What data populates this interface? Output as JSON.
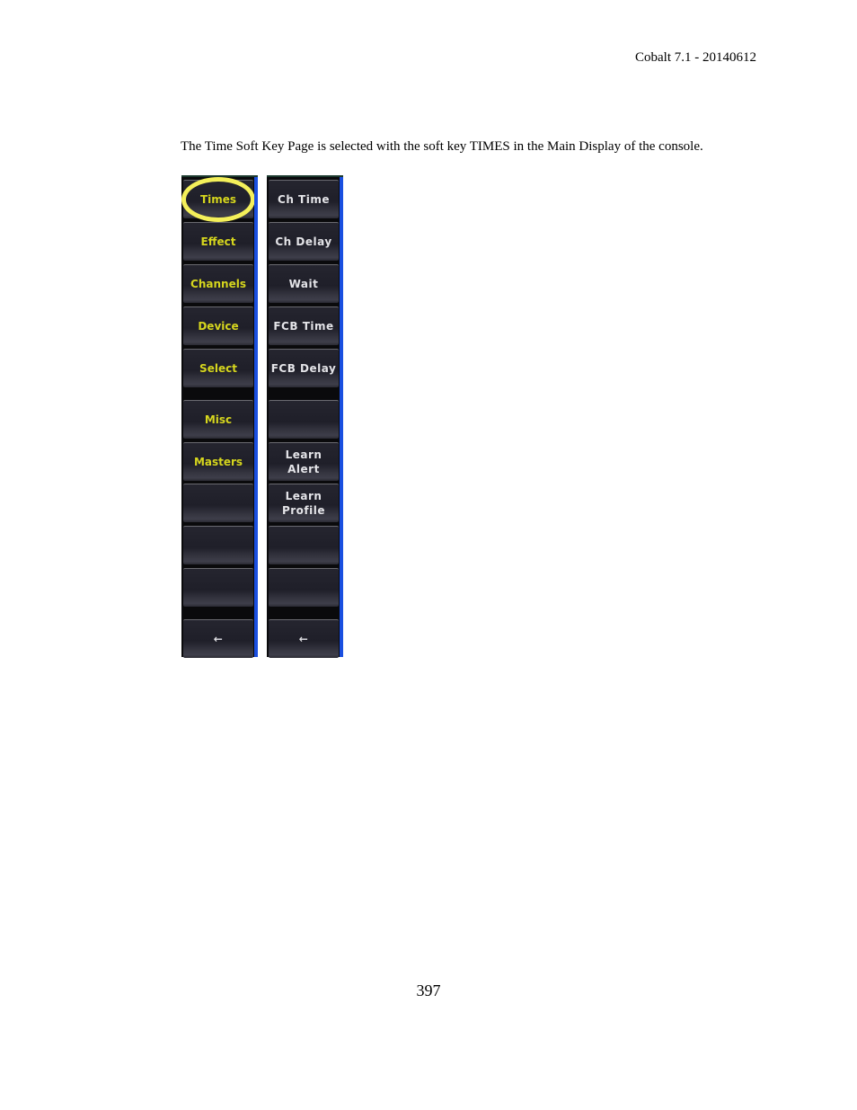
{
  "document": {
    "header_ref": "Cobalt 7.1 - 20140612",
    "intro_text": "The Time Soft Key Page is selected with the soft key TIMES in the Main Display of the console.",
    "page_number": "397"
  },
  "softkeys": {
    "colors": {
      "nav_text": "#d6d61e",
      "action_text": "#e4e4e8",
      "highlight": "#f4f05a",
      "edge_accent": "#1a4fe0"
    },
    "left_column": [
      {
        "label": "Times",
        "selected": true
      },
      {
        "label": "Effect"
      },
      {
        "label": "Channels"
      },
      {
        "label": "Device"
      },
      {
        "label": "Select"
      },
      {
        "label": "Misc"
      },
      {
        "label": "Masters"
      },
      {
        "label": ""
      },
      {
        "label": ""
      },
      {
        "label": ""
      },
      {
        "label": "←",
        "icon": "back-arrow-icon"
      }
    ],
    "right_column": [
      {
        "label": "Ch Time"
      },
      {
        "label": "Ch Delay"
      },
      {
        "label": "Wait"
      },
      {
        "label": "FCB Time"
      },
      {
        "label": "FCB Delay"
      },
      {
        "label": ""
      },
      {
        "label": "Learn Alert"
      },
      {
        "label": "Learn\nProfile"
      },
      {
        "label": ""
      },
      {
        "label": ""
      },
      {
        "label": "←",
        "icon": "back-arrow-icon"
      }
    ]
  }
}
